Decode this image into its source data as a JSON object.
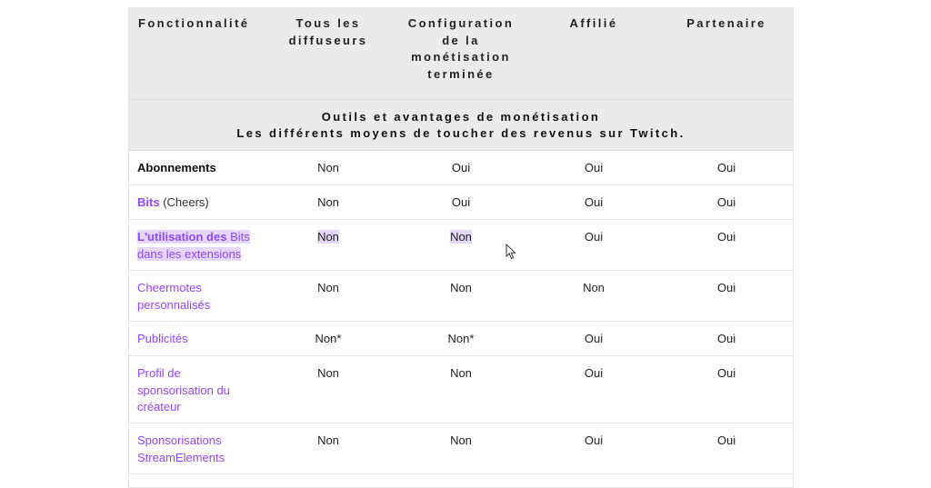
{
  "columns": [
    "Fonctionnalité",
    "Tous les diffuseurs",
    "Configuration de la monétisation terminée",
    "Affilié",
    "Partenaire"
  ],
  "section": {
    "title": "Outils et avantages de monétisation",
    "subtitle": "Les différents moyens de toucher des revenus sur Twitch."
  },
  "rows": [
    {
      "feature": "Abonnements",
      "values": [
        "Non",
        "Oui",
        "Oui",
        "Oui"
      ]
    },
    {
      "feature_link": "Bits",
      "feature_suffix": "(Cheers)",
      "values": [
        "Non",
        "Oui",
        "Oui",
        "Oui"
      ]
    },
    {
      "feature_part1": "L'utilisation des",
      "feature_part2": "Bits",
      "feature_part3": "dans les extensions",
      "values": [
        "Non",
        "Non",
        "Oui",
        "Oui"
      ]
    },
    {
      "feature": "Cheermotes personnalisés",
      "values": [
        "Non",
        "Non",
        "Non",
        "Oui"
      ]
    },
    {
      "feature": "Publicités",
      "values": [
        "Non*",
        "Non*",
        "Oui",
        "Oui"
      ]
    },
    {
      "feature": "Profil de sponsorisation du créateur",
      "values": [
        "Non",
        "Non",
        "Oui",
        "Oui"
      ]
    },
    {
      "feature": "Sponsorisations StreamElements",
      "values": [
        "Non",
        "Non",
        "Oui",
        "Oui"
      ]
    }
  ],
  "colors": {
    "link": "#9146ff",
    "header_bg": "#ebebeb",
    "highlight": "#e3d7fb"
  },
  "icons": {
    "cursor": "mouse-pointer-icon"
  }
}
